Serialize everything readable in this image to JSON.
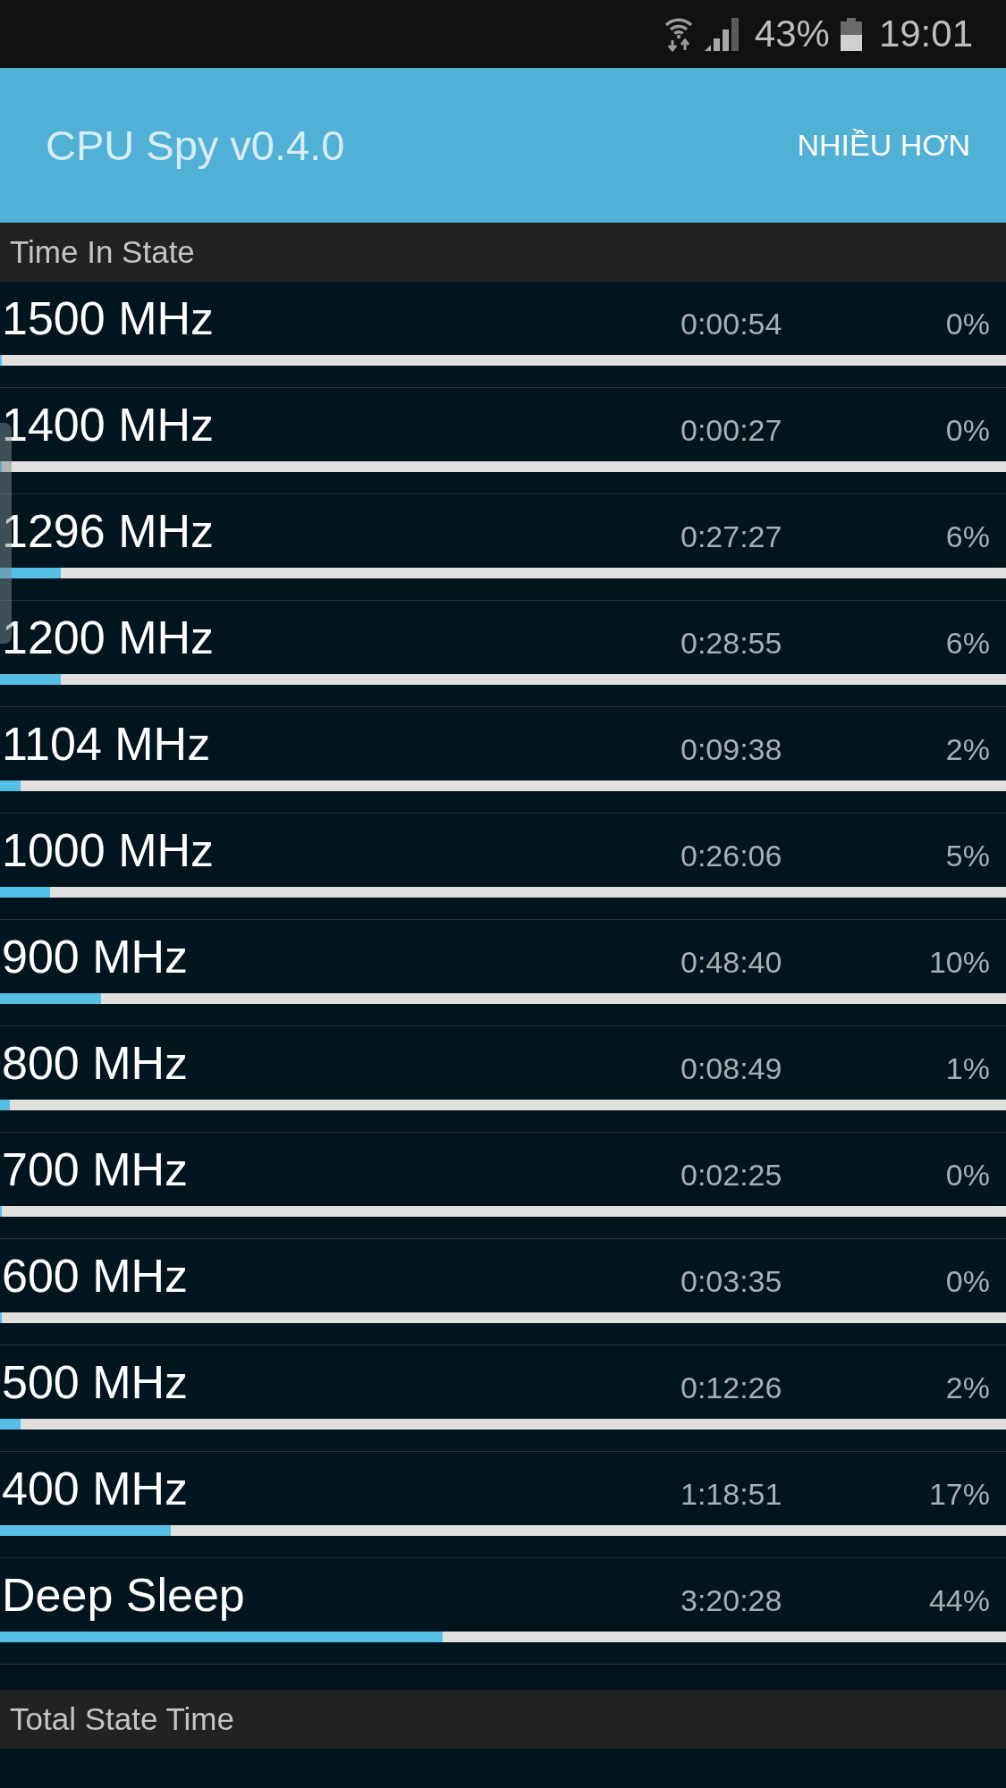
{
  "status_bar": {
    "battery": "43%",
    "time": "19:01"
  },
  "app_bar": {
    "title": "CPU Spy v0.4.0",
    "overflow_menu": "NHIỀU HƠN"
  },
  "time_in_state": {
    "heading": "Time In State",
    "states": [
      {
        "frequency": "1500 MHz",
        "time": "0:00:54",
        "percent": "0%",
        "level": 0
      },
      {
        "frequency": "1400 MHz",
        "time": "0:00:27",
        "percent": "0%",
        "level": 0
      },
      {
        "frequency": "1296 MHz",
        "time": "0:27:27",
        "percent": "6%",
        "level": 0.06
      },
      {
        "frequency": "1200 MHz",
        "time": "0:28:55",
        "percent": "6%",
        "level": 0.06
      },
      {
        "frequency": "1104 MHz",
        "time": "0:09:38",
        "percent": "2%",
        "level": 0.02
      },
      {
        "frequency": "1000 MHz",
        "time": "0:26:06",
        "percent": "5%",
        "level": 0.05
      },
      {
        "frequency": "900 MHz",
        "time": "0:48:40",
        "percent": "10%",
        "level": 0.1
      },
      {
        "frequency": "800 MHz",
        "time": "0:08:49",
        "percent": "1%",
        "level": 0.01
      },
      {
        "frequency": "700 MHz",
        "time": "0:02:25",
        "percent": "0%",
        "level": 0
      },
      {
        "frequency": "600 MHz",
        "time": "0:03:35",
        "percent": "0%",
        "level": 0
      },
      {
        "frequency": "500 MHz",
        "time": "0:12:26",
        "percent": "2%",
        "level": 0.02
      },
      {
        "frequency": "400 MHz",
        "time": "1:18:51",
        "percent": "17%",
        "level": 0.17
      },
      {
        "frequency": "Deep Sleep",
        "time": "3:20:28",
        "percent": "44%",
        "level": 0.44
      }
    ]
  },
  "total_state_time": {
    "heading": "Total State Time"
  }
}
